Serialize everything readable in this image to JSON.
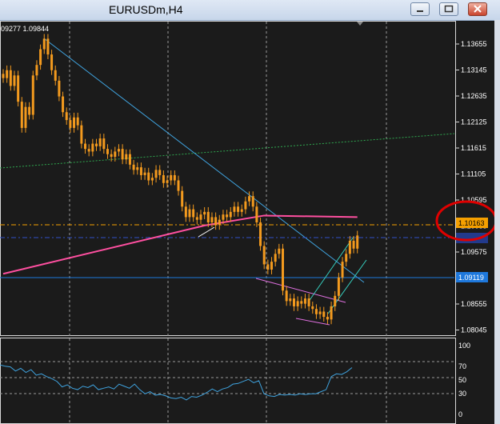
{
  "window": {
    "title": "EURUSDm,H4",
    "buttons": [
      "minimize",
      "restore",
      "close"
    ]
  },
  "chart": {
    "ohlc_label": "09277 1.09844",
    "price_ticks": [
      "1.13655",
      "1.13145",
      "1.12635",
      "1.12125",
      "1.11615",
      "1.11105",
      "1.10595",
      "1.10085",
      "1.09575",
      "1.09065",
      "1.08555",
      "1.08045"
    ],
    "price_badges": [
      {
        "label": "1.10163",
        "color": "#f5a000"
      },
      {
        "label": "1.09119",
        "color": "#1e78dc"
      }
    ],
    "indicator_ticks": [
      "100",
      "70",
      "50",
      "30",
      "0"
    ],
    "colors": {
      "candles": "#f39a1e",
      "ma": "#ff4fa0",
      "trend_line": "#3fa3df",
      "channel": "#36d0c0",
      "support": "#e070e0",
      "indicator": "#3fa3df",
      "highlight_circle": "#e00000"
    }
  },
  "chart_data": {
    "type": "candlestick",
    "symbol": "EURUSDm",
    "timeframe": "H4",
    "y_range": [
      1.0795,
      1.1385
    ],
    "indicator_range": [
      0,
      100
    ],
    "indicator_levels": [
      70,
      50,
      30
    ],
    "horizontal_lines": [
      1.10163,
      1.09119
    ],
    "closes": [
      1.1285,
      1.13,
      1.127,
      1.129,
      1.124,
      1.119,
      1.123,
      1.1215,
      1.129,
      1.131,
      1.134,
      1.136,
      1.133,
      1.13,
      1.128,
      1.125,
      1.122,
      1.1205,
      1.119,
      1.121,
      1.1195,
      1.116,
      1.115,
      1.1145,
      1.116,
      1.1155,
      1.117,
      1.115,
      1.114,
      1.1135,
      1.1145,
      1.115,
      1.113,
      1.114,
      1.112,
      1.111,
      1.1115,
      1.11,
      1.1105,
      1.109,
      1.1095,
      1.111,
      1.11,
      1.1085,
      1.109,
      1.11,
      1.109,
      1.107,
      1.104,
      1.102,
      1.1035,
      1.102,
      1.1015,
      1.1025,
      1.103,
      1.101,
      1.102,
      1.1005,
      1.1015,
      1.1025,
      1.102,
      1.103,
      1.104,
      1.103,
      1.1035,
      1.105,
      1.106,
      1.104,
      1.101,
      1.0965,
      1.093,
      1.092,
      1.0935,
      1.095,
      1.096,
      1.088,
      1.086,
      1.0865,
      1.085,
      1.086,
      1.0855,
      1.0865,
      1.085,
      1.0845,
      1.0835,
      1.084,
      1.083,
      1.0825,
      1.085,
      1.087,
      1.0905,
      1.0935,
      1.095,
      1.0975,
      1.096,
      1.0985
    ],
    "ma_endpoints": [
      [
        0,
        1.0912
      ],
      [
        54,
        1.1004
      ],
      [
        70,
        1.1023
      ],
      [
        95,
        1.102
      ]
    ],
    "indicator": [
      72,
      70,
      69,
      63,
      67,
      61,
      65,
      57,
      59,
      55,
      52,
      48,
      40,
      43,
      38,
      36,
      41,
      39,
      43,
      36,
      38,
      40,
      37,
      44,
      41,
      38,
      44,
      36,
      30,
      33,
      28,
      29,
      27,
      24,
      23,
      25,
      21,
      26,
      25,
      28,
      32,
      37,
      33,
      37,
      39,
      44,
      45,
      48,
      51,
      46,
      49,
      30,
      27,
      26,
      29,
      28,
      29,
      28,
      30,
      29,
      30,
      30,
      33,
      36,
      55,
      59,
      58,
      62,
      68
    ]
  }
}
